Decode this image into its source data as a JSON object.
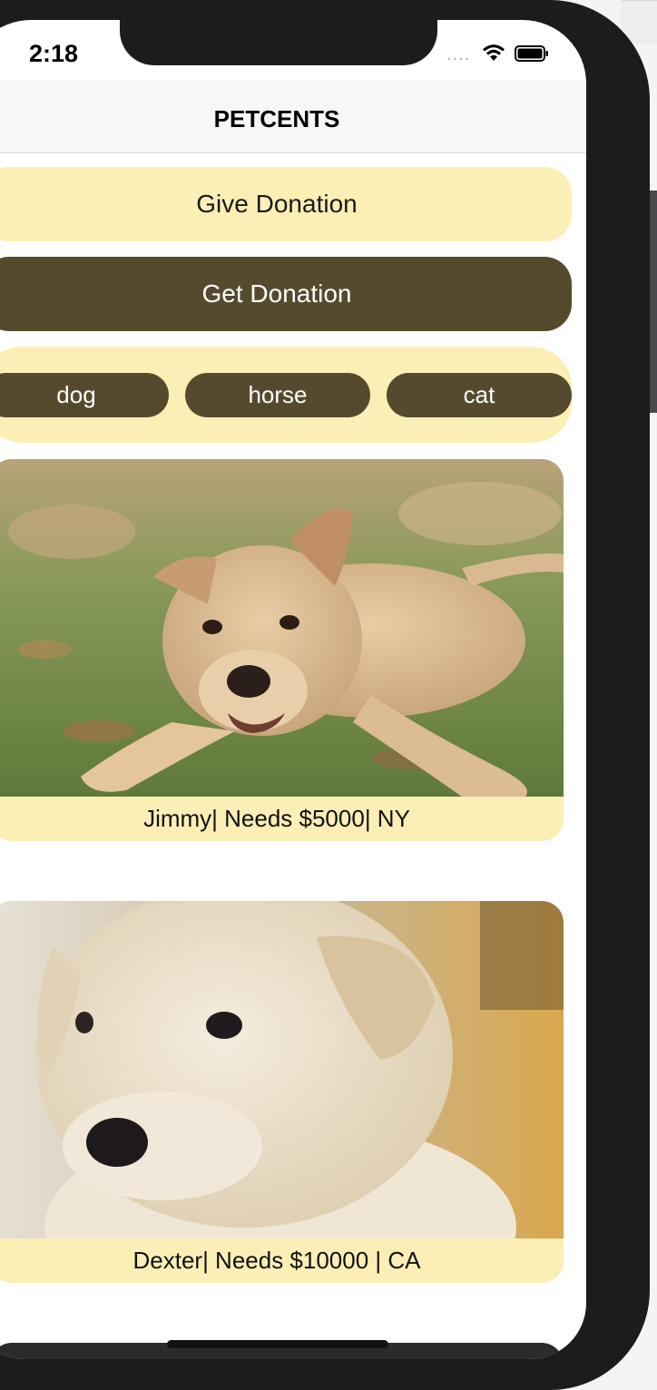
{
  "status_bar": {
    "time": "2:18",
    "signal": "....",
    "wifi_icon": "wifi-icon",
    "battery_icon": "battery-icon"
  },
  "nav": {
    "title": "PETCENTS"
  },
  "actions": {
    "give_label": "Give Donation",
    "get_label": "Get Donation"
  },
  "filters": [
    {
      "label": "dog"
    },
    {
      "label": "horse"
    },
    {
      "label": "cat"
    }
  ],
  "pets": [
    {
      "caption": "Jimmy| Needs $5000| NY",
      "photo": "puppy-photo"
    },
    {
      "caption": "Dexter| Needs $10000 | CA",
      "photo": "puppy-photo"
    }
  ],
  "colors": {
    "accent_light": "#fcefb5",
    "accent_dark": "#564a2e"
  }
}
